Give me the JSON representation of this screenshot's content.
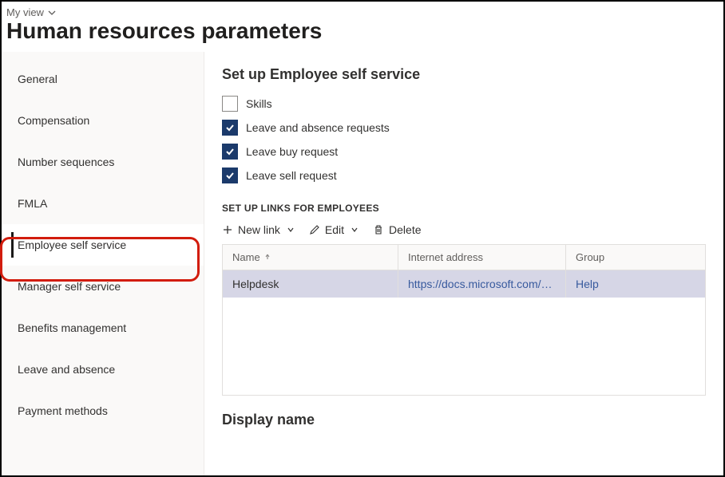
{
  "viewSelector": {
    "label": "My view"
  },
  "pageTitle": "Human resources parameters",
  "sidebar": {
    "items": [
      {
        "label": "General"
      },
      {
        "label": "Compensation"
      },
      {
        "label": "Number sequences"
      },
      {
        "label": "FMLA"
      },
      {
        "label": "Employee self service",
        "active": true,
        "highlighted": true
      },
      {
        "label": "Manager self service"
      },
      {
        "label": "Benefits management"
      },
      {
        "label": "Leave and absence"
      },
      {
        "label": "Payment methods"
      }
    ]
  },
  "main": {
    "sectionTitle": "Set up Employee self service",
    "checks": [
      {
        "label": "Skills",
        "checked": false
      },
      {
        "label": "Leave and absence requests",
        "checked": true
      },
      {
        "label": "Leave buy request",
        "checked": true
      },
      {
        "label": "Leave sell request",
        "checked": true
      }
    ],
    "linksSubheader": "SET UP LINKS FOR EMPLOYEES",
    "toolbar": {
      "newLink": "New link",
      "edit": "Edit",
      "delete": "Delete"
    },
    "grid": {
      "columns": {
        "name": "Name",
        "internetAddress": "Internet address",
        "group": "Group"
      },
      "rows": [
        {
          "name": "Helpdesk",
          "address": "https://docs.microsoft.com/en-u...",
          "group": "Help"
        }
      ]
    },
    "displayNameTitle": "Display name"
  }
}
